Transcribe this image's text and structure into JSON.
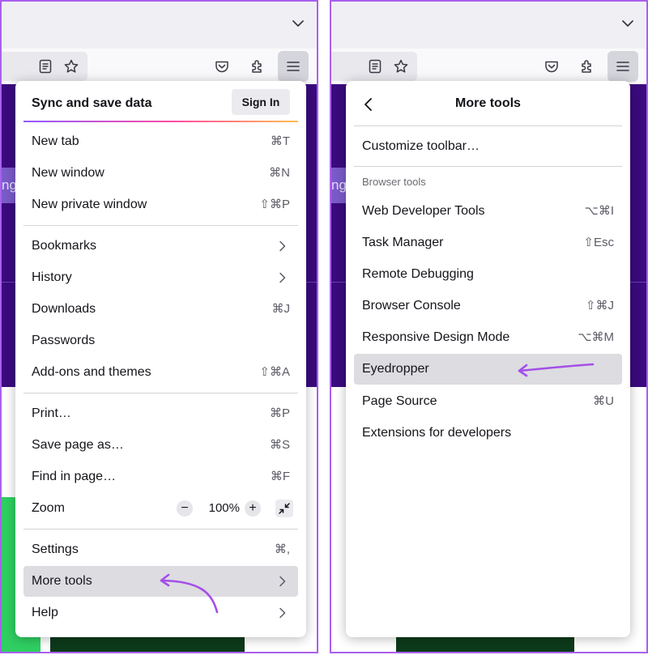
{
  "colors": {
    "border_accent": "#a960ee",
    "annotation_arrow": "#a54ee8",
    "highlight": "#dcdce1",
    "page_purple": "#3a0a7e",
    "page_green": "#2fcf62"
  },
  "browser": {
    "tab_overflow_icon": "chevron-down-icon",
    "toolbar_icons": [
      "reader-view-icon",
      "bookmark-star-icon",
      "pocket-icon",
      "extensions-icon",
      "hamburger-menu-icon"
    ],
    "side_chip_left": "ng",
    "side_chip_right": "ng"
  },
  "left_menu": {
    "sync_title": "Sync and save data",
    "sign_in": "Sign In",
    "items_group1": [
      {
        "label": "New tab",
        "shortcut": "⌘T"
      },
      {
        "label": "New window",
        "shortcut": "⌘N"
      },
      {
        "label": "New private window",
        "shortcut": "⇧⌘P"
      }
    ],
    "items_group2": [
      {
        "label": "Bookmarks",
        "shortcut": ""
      },
      {
        "label": "History",
        "shortcut": ""
      },
      {
        "label": "Downloads",
        "shortcut": "⌘J"
      },
      {
        "label": "Passwords",
        "shortcut": ""
      },
      {
        "label": "Add-ons and themes",
        "shortcut": "⇧⌘A"
      }
    ],
    "items_group3": [
      {
        "label": "Print…",
        "shortcut": "⌘P"
      },
      {
        "label": "Save page as…",
        "shortcut": "⌘S"
      },
      {
        "label": "Find in page…",
        "shortcut": "⌘F"
      }
    ],
    "zoom": {
      "label": "Zoom",
      "minus": "−",
      "value": "100%",
      "plus": "+"
    },
    "items_group4": [
      {
        "label": "Settings",
        "shortcut": "⌘,"
      },
      {
        "label": "More tools",
        "shortcut": ""
      },
      {
        "label": "Help",
        "shortcut": ""
      }
    ]
  },
  "right_menu": {
    "title": "More tools",
    "customize": "Customize toolbar…",
    "section_header": "Browser tools",
    "items": [
      {
        "label": "Web Developer Tools",
        "shortcut": "⌥⌘I"
      },
      {
        "label": "Task Manager",
        "shortcut": "⇧Esc"
      },
      {
        "label": "Remote Debugging",
        "shortcut": ""
      },
      {
        "label": "Browser Console",
        "shortcut": "⇧⌘J"
      },
      {
        "label": "Responsive Design Mode",
        "shortcut": "⌥⌘M"
      },
      {
        "label": "Eyedropper",
        "shortcut": ""
      },
      {
        "label": "Page Source",
        "shortcut": "⌘U"
      },
      {
        "label": "Extensions for developers",
        "shortcut": ""
      }
    ]
  }
}
